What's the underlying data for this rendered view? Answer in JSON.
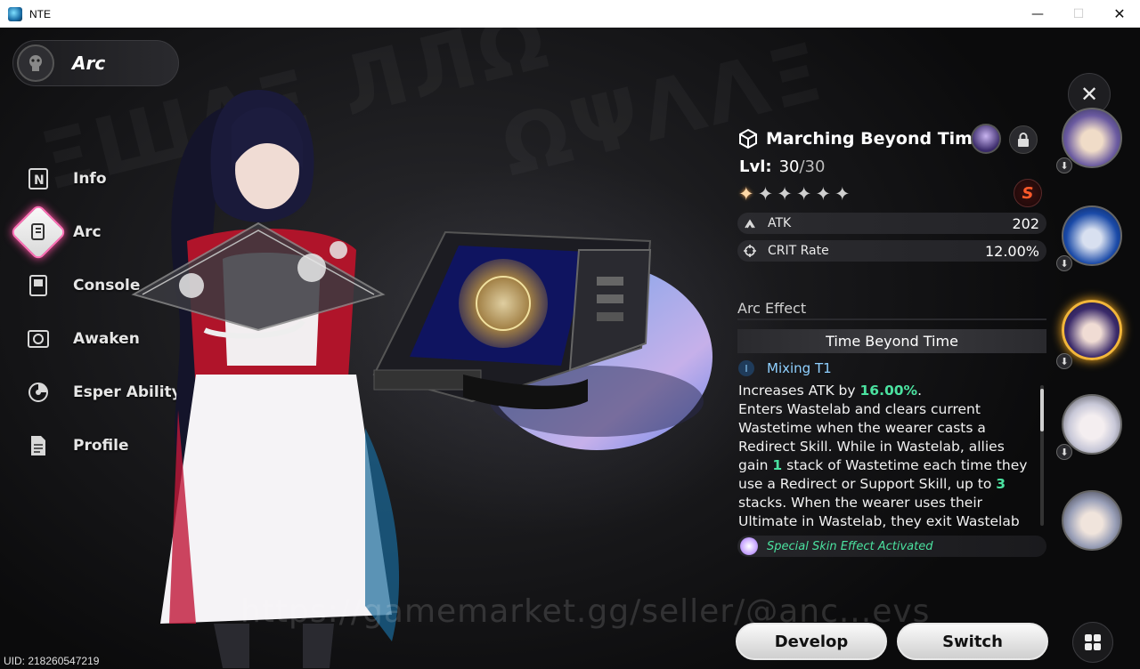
{
  "window": {
    "title": "NTE",
    "minimize": "—",
    "maximize": "☐",
    "close": "✕"
  },
  "header": {
    "title": "Arc"
  },
  "nav": {
    "items": [
      {
        "label": "Info",
        "icon": "info-icon"
      },
      {
        "label": "Arc",
        "icon": "arc-icon",
        "active": true
      },
      {
        "label": "Console",
        "icon": "console-icon"
      },
      {
        "label": "Awaken",
        "icon": "awaken-icon"
      },
      {
        "label": "Esper Ability",
        "icon": "esper-ability-icon"
      },
      {
        "label": "Profile",
        "icon": "profile-icon"
      }
    ]
  },
  "arc": {
    "name": "Marching Beyond Time",
    "level_label": "Lvl:",
    "level_current": "30",
    "level_max": "/30",
    "stars_total": 6,
    "stars_filled": 1,
    "rank": "S",
    "stats": [
      {
        "name": "ATK",
        "value": "202",
        "icon": "atk-icon"
      },
      {
        "name": "CRIT Rate",
        "value": "12.00%",
        "icon": "crit-icon"
      }
    ],
    "effect_section": "Arc Effect",
    "effect_tab": "Time Beyond Time",
    "tier_badge": "I",
    "tier_label": "Mixing T1",
    "effect_parts": {
      "p1": "Increases ATK by ",
      "v1": "16.00%",
      "p2": ".",
      "p3": "Enters Wastelab and clears current Wastetime when the wearer casts a Redirect Skill. While in Wastelab, allies gain ",
      "v2": "1",
      "p4": " stack of Wastetime each time they use a Redirect or Support Skill, up to ",
      "v3": "3",
      "p5": " stacks. When the wearer uses their Ultimate in Wastelab, they exit Wastelab"
    },
    "skin_effect": "Special Skin Effect Activated"
  },
  "buttons": {
    "develop": "Develop",
    "switch": "Switch",
    "close": "✕"
  },
  "watermark": "https://gamemarket.gg/seller/@anc...evs",
  "uid": "UID: 218260547219",
  "colors": {
    "accent_green": "#4be2a0",
    "tier_blue": "#8fd0ff",
    "active_gold": "#f2b63a",
    "nav_active_pink": "#ff6fb6"
  }
}
